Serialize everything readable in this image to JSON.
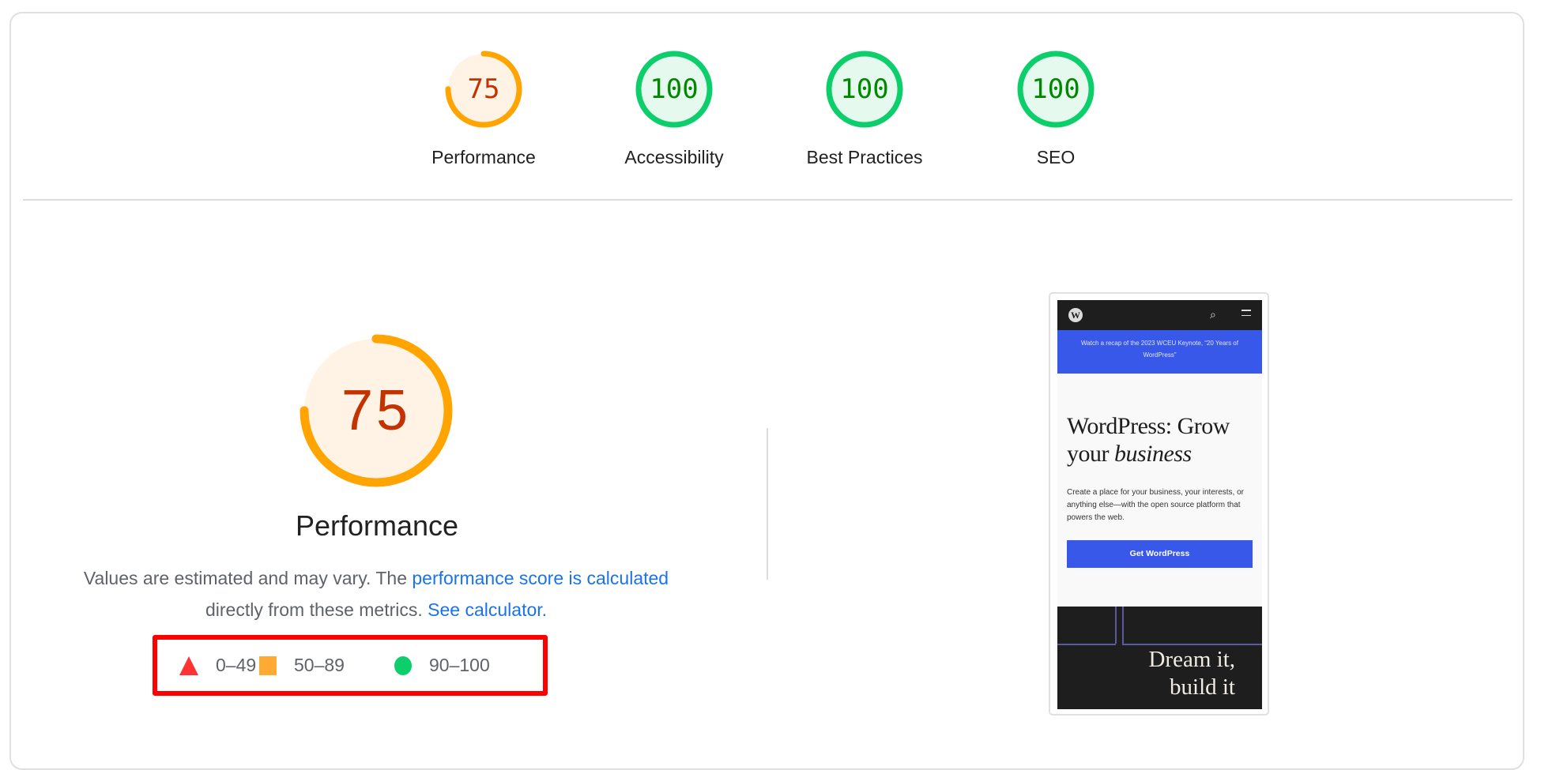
{
  "summary": {
    "gauges": [
      {
        "label": "Performance",
        "score": "75",
        "value": 75,
        "rating": "average"
      },
      {
        "label": "Accessibility",
        "score": "100",
        "value": 100,
        "rating": "pass"
      },
      {
        "label": "Best Practices",
        "score": "100",
        "value": 100,
        "rating": "pass"
      },
      {
        "label": "SEO",
        "score": "100",
        "value": 100,
        "rating": "pass"
      }
    ]
  },
  "performance": {
    "score": "75",
    "value": 75,
    "title": "Performance",
    "desc_prefix": "Values are estimated and may vary. The ",
    "desc_link1": "performance score is calculated",
    "desc_middle": " directly from these metrics. ",
    "desc_link2": "See calculator."
  },
  "legend": {
    "items": [
      {
        "icon": "fail-triangle-icon",
        "range": "0–49"
      },
      {
        "icon": "average-square-icon",
        "range": "50–89"
      },
      {
        "icon": "pass-circle-icon",
        "range": "90–100"
      }
    ]
  },
  "colors": {
    "average": "#ffa400",
    "average_text": "#c33300",
    "average_bg": "#fff3e6",
    "pass": "#0cce6b",
    "pass_text": "#008800",
    "pass_bg": "#e6f9ee",
    "fail": "#ff3333",
    "link": "#1a73e8",
    "highlight": "#ff0000"
  },
  "screenshot": {
    "logo_letter": "W",
    "search_glyph": "⌕",
    "banner": "Watch a recap of the 2023 WCEU Keynote, “20 Years of WordPress”",
    "heading_plain": "WordPress: Grow your ",
    "heading_italic": "business",
    "paragraph": "Create a place for your business, your interests, or anything else—with the open source platform that powers the web.",
    "button": "Get WordPress",
    "dark_line1": "Dream it,",
    "dark_line2": "build it"
  }
}
